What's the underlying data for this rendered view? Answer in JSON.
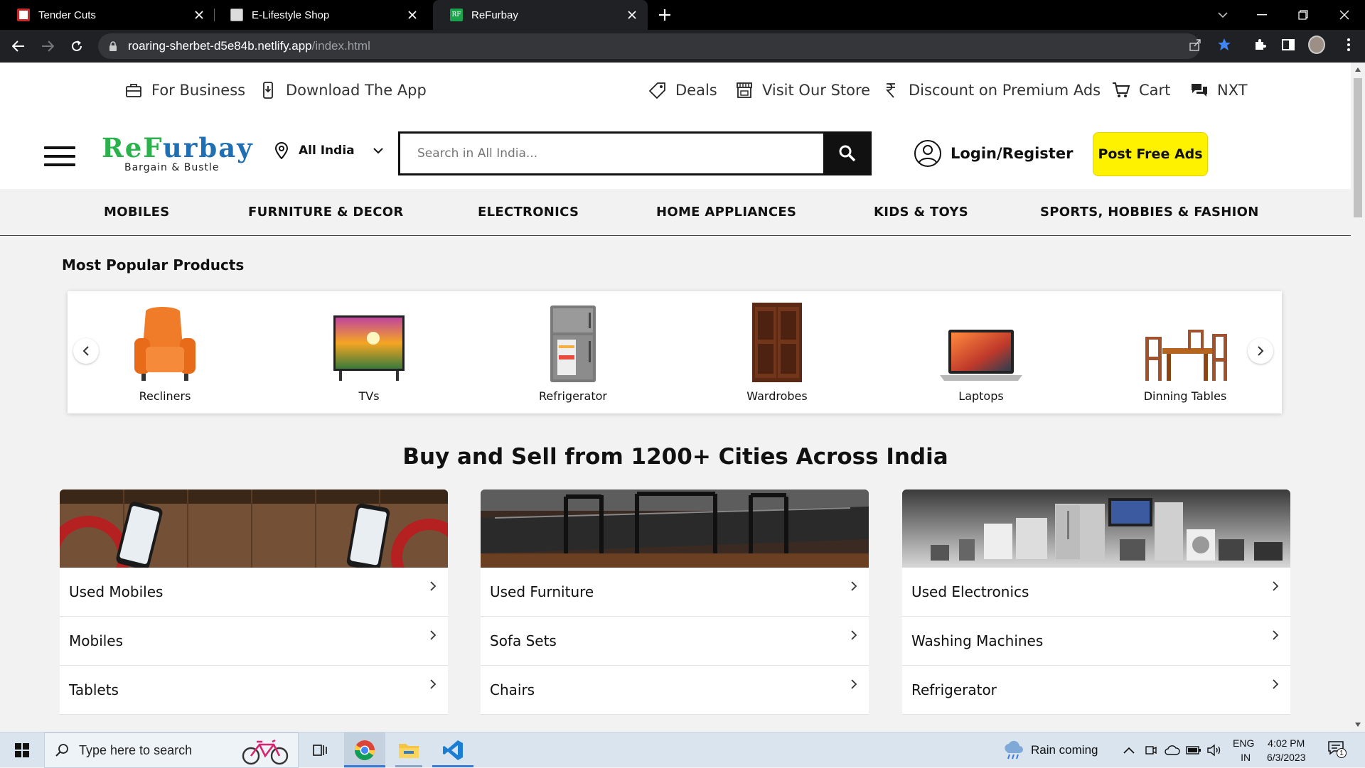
{
  "browser": {
    "tabs": [
      {
        "title": "Tender Cuts",
        "active": false,
        "favicon_color": "#c62828"
      },
      {
        "title": "E-Lifestyle Shop",
        "active": false,
        "favicon_color": "#9e9e9e"
      },
      {
        "title": "ReFurbay",
        "active": true,
        "favicon_color": "#1aa34a",
        "favicon_text": "RF"
      }
    ],
    "url_domain": "roaring-sherbet-d5e84b.netlify.app",
    "url_path": "/index.html"
  },
  "topbar": {
    "left_links": [
      {
        "label": "For Business",
        "icon": "briefcase-icon"
      },
      {
        "label": "Download The App",
        "icon": "phone-download-icon"
      }
    ],
    "right_links": [
      {
        "label": "Deals",
        "icon": "tag-icon"
      },
      {
        "label": "Visit Our Store",
        "icon": "store-icon"
      },
      {
        "label": "Discount on Premium Ads",
        "icon": "rupee-icon"
      },
      {
        "label": "Cart",
        "icon": "cart-icon"
      },
      {
        "label": "NXT",
        "icon": "chat-icon"
      }
    ]
  },
  "header": {
    "logo_main": "ReFurbay",
    "logo_tagline": "Bargain & Bustle",
    "location": "All India",
    "search_placeholder": "Search in All India...",
    "login_label": "Login/Register",
    "post_ad_label": "Post Free Ads",
    "colors": {
      "logo_green": "#2bb24c",
      "logo_blue": "#1f6fb2",
      "cta_yellow": "#fff200"
    }
  },
  "categories": [
    "MOBILES",
    "FURNITURE & DECOR",
    "ELECTRONICS",
    "HOME APPLIANCES",
    "KIDS & TOYS",
    "SPORTS, HOBBIES & FASHION"
  ],
  "popular": {
    "title": "Most Popular Products",
    "items": [
      "Recliners",
      "TVs",
      "Refrigerator",
      "Wardrobes",
      "Laptops",
      "Dinning Tables"
    ]
  },
  "cities_title": "Buy and Sell from 1200+ Cities Across India",
  "cards": [
    {
      "rows": [
        "Used Mobiles",
        "Mobiles",
        "Tablets"
      ]
    },
    {
      "rows": [
        "Used Furniture",
        "Sofa Sets",
        "Chairs"
      ]
    },
    {
      "rows": [
        "Used Electronics",
        "Washing Machines",
        "Refrigerator"
      ]
    }
  ],
  "taskbar": {
    "search_placeholder": "Type here to search",
    "weather": "Rain coming",
    "lang_top": "ENG",
    "lang_bottom": "IN",
    "time": "4:02 PM",
    "date": "6/3/2023",
    "notification_count": "1"
  }
}
